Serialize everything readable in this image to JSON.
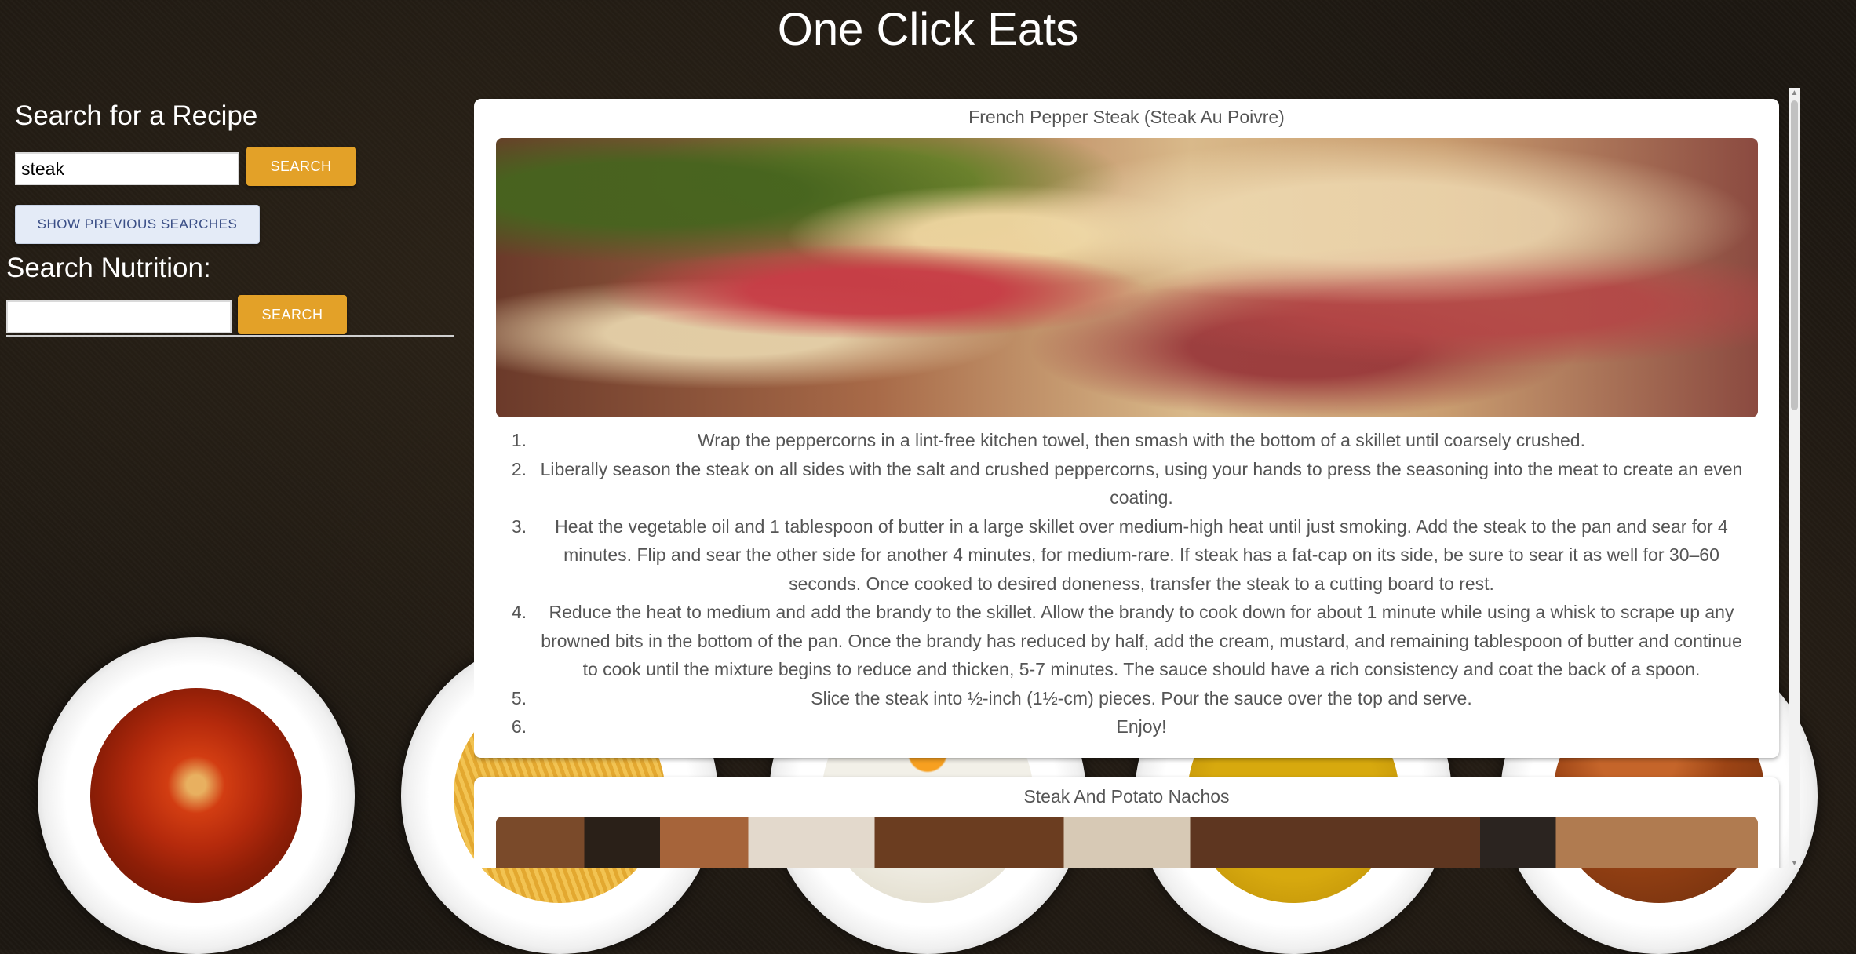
{
  "app": {
    "title": "One Click Eats"
  },
  "recipe_search": {
    "heading": "Search for a Recipe",
    "input_value": "steak",
    "button_label": "SEARCH",
    "history_button_label": "SHOW PREVIOUS SEARCHES"
  },
  "nutrition_search": {
    "heading": "Search Nutrition:",
    "input_value": "",
    "button_label": "SEARCH"
  },
  "results": [
    {
      "title": "French Pepper Steak (Steak Au Poivre)",
      "steps": [
        "Wrap the peppercorns in a lint-free kitchen towel, then smash with the bottom of a skillet until coarsely crushed.",
        "Liberally season the steak on all sides with the salt and crushed peppercorns, using your hands to press the seasoning into the meat to create an even coating.",
        "Heat the vegetable oil and 1 tablespoon of butter in a large skillet over medium-high heat until just smoking. Add the steak to the pan and sear for 4 minutes. Flip and sear the other side for another 4 minutes, for medium-rare. If steak has a fat-cap on its side, be sure to sear it as well for 30–60 seconds. Once cooked to desired doneness, transfer the steak to a cutting board to rest.",
        "Reduce the heat to medium and add the brandy to the skillet. Allow the brandy to cook down for about 1 minute while using a whisk to scrape up any browned bits in the bottom of the pan. Once the brandy has reduced by half, add the cream, mustard, and remaining tablespoon of butter and continue to cook until the mixture begins to reduce and thicken, 5-7 minutes. The sauce should have a rich consistency and coat the back of a spoon.",
        "Slice the steak into ½-inch (1½-cm) pieces. Pour the sauce over the top and serve.",
        "Enjoy!"
      ],
      "step_numbers": [
        "1.",
        "2.",
        "3.",
        "4.",
        "5.",
        "6."
      ]
    },
    {
      "title": "Steak And Potato Nachos"
    }
  ],
  "colors": {
    "accent": "#e3a128",
    "history_button_bg": "#e4ebf7",
    "background": "#1d1812"
  }
}
